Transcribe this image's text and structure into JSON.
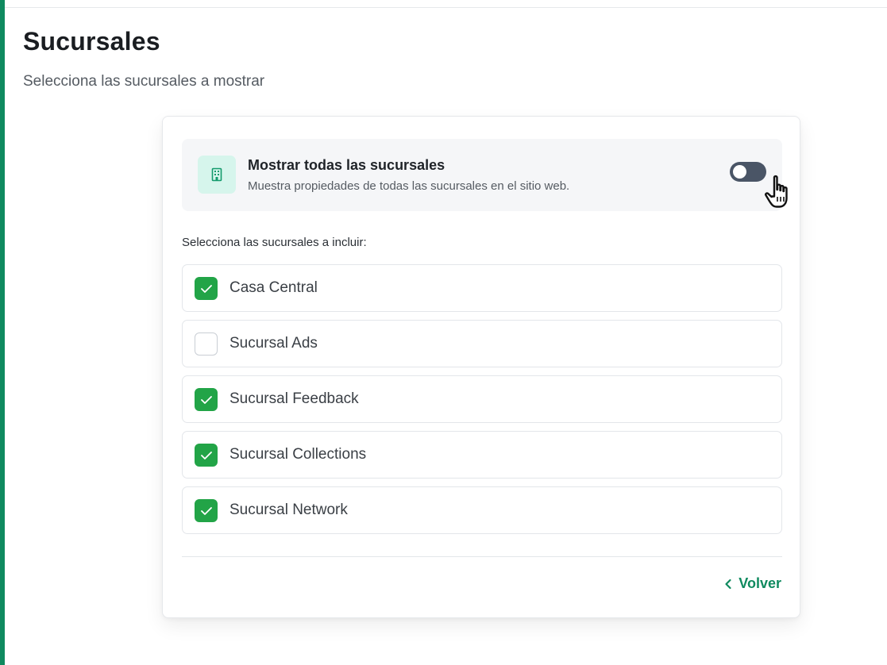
{
  "page": {
    "title": "Sucursales",
    "subtitle": "Selecciona las sucursales a mostrar"
  },
  "show_all": {
    "title": "Mostrar todas las sucursales",
    "description": "Muestra propiedades de todas las sucursales en el sitio web.",
    "enabled": false,
    "icon": "building-icon"
  },
  "branches": {
    "label": "Selecciona las sucursales a incluir:",
    "items": [
      {
        "label": "Casa Central",
        "checked": true
      },
      {
        "label": "Sucursal Ads",
        "checked": false
      },
      {
        "label": "Sucursal Feedback",
        "checked": true
      },
      {
        "label": "Sucursal Collections",
        "checked": true
      },
      {
        "label": "Sucursal Network",
        "checked": true
      }
    ]
  },
  "footer": {
    "back_label": "Volver"
  },
  "colors": {
    "accent": "#0f8a5f",
    "checkbox_checked": "#22a447",
    "toggle_off": "#4a5566",
    "icon_bg": "#d6f5ec"
  }
}
